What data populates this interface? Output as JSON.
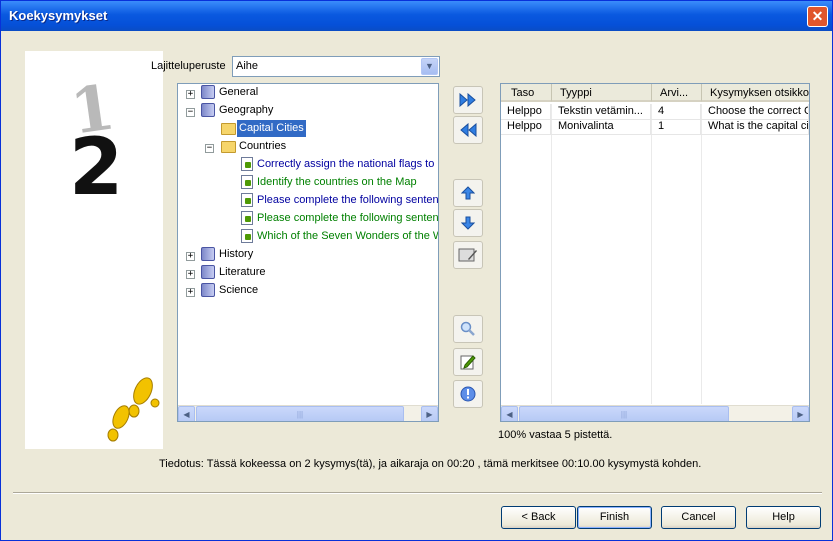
{
  "window": {
    "title": "Koekysymykset",
    "close_symbol": "✕"
  },
  "sort": {
    "label": "Lajitteluperuste",
    "value": "Aihe"
  },
  "tree": [
    {
      "label": "General",
      "expander": "+"
    },
    {
      "label": "Geography",
      "expander": "−"
    },
    {
      "label": "Capital Cities"
    },
    {
      "label": "Countries",
      "expander": "−"
    },
    {
      "label": "Correctly assign the national flags to"
    },
    {
      "label": "Identify the countries on the Map"
    },
    {
      "label": "Please complete the following senten"
    },
    {
      "label": "Please complete the following senten"
    },
    {
      "label": "Which of the Seven Wonders of the W"
    },
    {
      "label": "History",
      "expander": "+"
    },
    {
      "label": "Literature",
      "expander": "+"
    },
    {
      "label": "Science",
      "expander": "+"
    }
  ],
  "middle_icons": [
    "add-all-icon",
    "remove-all-icon",
    "move-up-icon",
    "move-down-icon",
    "edit-points-icon",
    "preview-icon",
    "edit-icon",
    "info-icon"
  ],
  "grid": {
    "columns": [
      "Taso",
      "Tyyppi",
      "Arvi...",
      "Kysymyksen otsikko"
    ],
    "rows": [
      [
        "Helppo",
        "Tekstin vetämin...",
        "4",
        "Choose the correct C"
      ],
      [
        "Helppo",
        "Monivalinta",
        "1",
        "What is the capital ci"
      ]
    ]
  },
  "score_note": "100% vastaa 5 pistettä.",
  "notice": "Tiedotus: Tässä kokeessa on 2 kysymys(tä), ja aikaraja on 00:20 , tämä merkitsee 00:10.00 kysymystä kohden.",
  "wizard": {
    "step_prev": "1",
    "step_current": "2"
  },
  "buttons": {
    "back": "< Back",
    "finish": "Finish",
    "cancel": "Cancel",
    "help": "Help"
  },
  "colors": {
    "title_bar": "#0a59e0",
    "selection": "#316ac5",
    "link_blue": "#0000a0",
    "link_green": "#008000"
  }
}
